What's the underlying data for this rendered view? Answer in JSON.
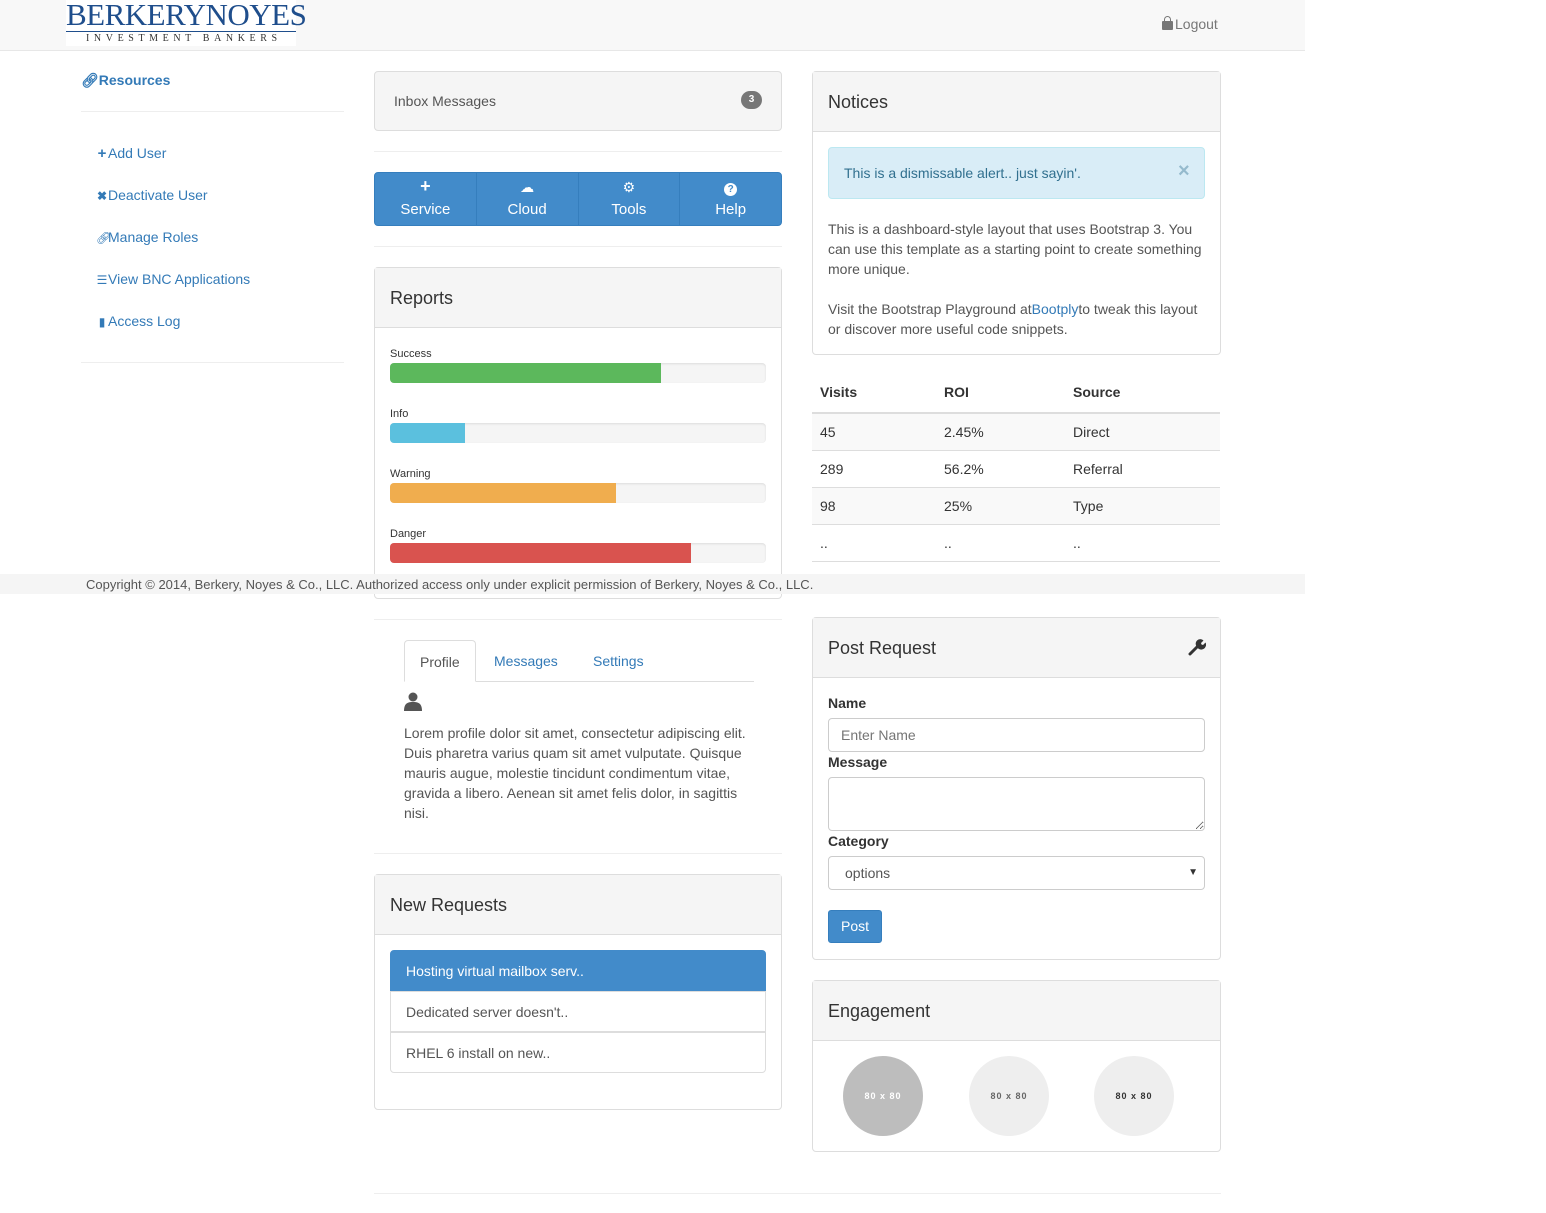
{
  "header": {
    "logo_main": "BERKERYNOYES",
    "logo_sub": "INVESTMENT BANKERS",
    "logout_label": "Logout"
  },
  "sidebar": {
    "resources_label": "Resources",
    "items": [
      {
        "label": "Add User",
        "icon": "plus-icon"
      },
      {
        "label": "Deactivate User",
        "icon": "x-icon"
      },
      {
        "label": "Manage Roles",
        "icon": "link-icon"
      },
      {
        "label": "View BNC Applications",
        "icon": "list-icon"
      },
      {
        "label": "Access Log",
        "icon": "book-icon"
      }
    ]
  },
  "inbox": {
    "label": "Inbox Messages",
    "count": "3"
  },
  "toolbar": {
    "buttons": [
      {
        "label": "Service",
        "icon": "plus-icon"
      },
      {
        "label": "Cloud",
        "icon": "cloud-icon"
      },
      {
        "label": "Tools",
        "icon": "gear-icon"
      },
      {
        "label": "Help",
        "icon": "question-icon"
      }
    ]
  },
  "reports": {
    "title": "Reports",
    "bars": [
      {
        "label": "Success",
        "value": 72,
        "color": "#5cb85c"
      },
      {
        "label": "Info",
        "value": 20,
        "color": "#5bc0de"
      },
      {
        "label": "Warning",
        "value": 60,
        "color": "#f0ad4e"
      },
      {
        "label": "Danger",
        "value": 80,
        "color": "#d9534f"
      }
    ]
  },
  "notices": {
    "title": "Notices",
    "alert": "This is a dismissable alert.. just sayin'.",
    "close_glyph": "×",
    "para1": "This is a dashboard-style layout that uses Bootstrap 3. You can use this template as a starting point to create something more unique.",
    "para2_before": "Visit the Bootstrap Playground at",
    "para2_link": "Bootply",
    "para2_after": "to tweak this layout or discover more useful code snippets."
  },
  "table": {
    "headers": [
      "Visits",
      "ROI",
      "Source"
    ],
    "rows": [
      [
        "45",
        "2.45%",
        "Direct"
      ],
      [
        "289",
        "56.2%",
        "Referral"
      ],
      [
        "98",
        "25%",
        "Type"
      ],
      [
        "..",
        "..",
        ".."
      ]
    ]
  },
  "footer": {
    "text": "Copyright © 2014, Berkery, Noyes & Co., LLC. Authorized access only under explicit permission of Berkery, Noyes & Co., LLC."
  },
  "tabs": {
    "items": [
      "Profile",
      "Messages",
      "Settings"
    ],
    "active": "Profile",
    "profile_text": "Lorem profile dolor sit amet, consectetur adipiscing elit. Duis pharetra varius quam sit amet vulputate. Quisque mauris augue, molestie tincidunt condimentum vitae, gravida a libero. Aenean sit amet felis dolor, in sagittis nisi."
  },
  "requests": {
    "title": "New Requests",
    "items": [
      "Hosting virtual mailbox serv..",
      "Dedicated server doesn't..",
      "RHEL 6 install on new.."
    ]
  },
  "post_request": {
    "title": "Post Request",
    "name_label": "Name",
    "name_placeholder": "Enter Name",
    "message_label": "Message",
    "category_label": "Category",
    "category_value": "options",
    "post_label": "Post"
  },
  "engagement": {
    "title": "Engagement",
    "circles": [
      "80 x 80",
      "80 x 80",
      "80 x 80"
    ]
  },
  "colors": {
    "primary": "#428bca",
    "link": "#337ab7",
    "alert_bg": "#d9edf7",
    "alert_text": "#31708f"
  }
}
